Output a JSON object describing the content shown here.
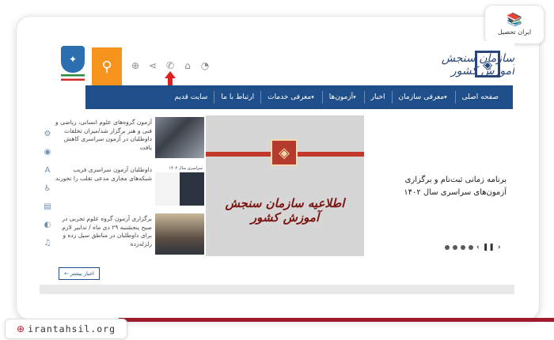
{
  "brand": {
    "logo_text": "ایران تحصیل",
    "url": "irantahsil.org",
    "accent": "#9e1b2e"
  },
  "site": {
    "org_name": "سازمان سنجش آموزش کشور",
    "nav": {
      "items": [
        {
          "label": "صفحه اصلی",
          "caret": false
        },
        {
          "label": "معرفی سازمان",
          "caret": true
        },
        {
          "label": "اخبار",
          "caret": false
        },
        {
          "label": "آزمون‌ها",
          "caret": true
        },
        {
          "label": "معرفی خدمات",
          "caret": true
        },
        {
          "label": "ارتباط با ما",
          "caret": false
        },
        {
          "label": "سایت قدیم",
          "caret": false
        }
      ],
      "color": "#1f4f8b"
    },
    "search_color": "#f7941d",
    "news": [
      {
        "text": "آزمون گروه‌های علوم انسانی، ریاضی و فنی و هنر برگزار شد/میزان تخلفات داوطلبان در آزمون سراسری کاهش یافت",
        "caption": ""
      },
      {
        "text": "داوطلبان آزمون سراسری فریب شبکه‌های مجازی مدعی تقلب را نخورند",
        "caption": "سراسری سال ۱۴۰۲"
      },
      {
        "text": "برگزاری آزمون گروه علوم تجربی در صبح پنجشنبه ۲۹ دی ماه / تدابیر لازم برای داوطلبان در مناطق سیل زده و زلزله‌زده",
        "caption": ""
      }
    ],
    "banner_title": "اطلاعیه سازمان سنجش آموزش کشور",
    "slide_title": "برنامه زمانی ثبت‌نام و برگزاری آزمون‌های سراسری سال ۱۴۰۲",
    "more_news_label": "اخبار بیشتر"
  }
}
